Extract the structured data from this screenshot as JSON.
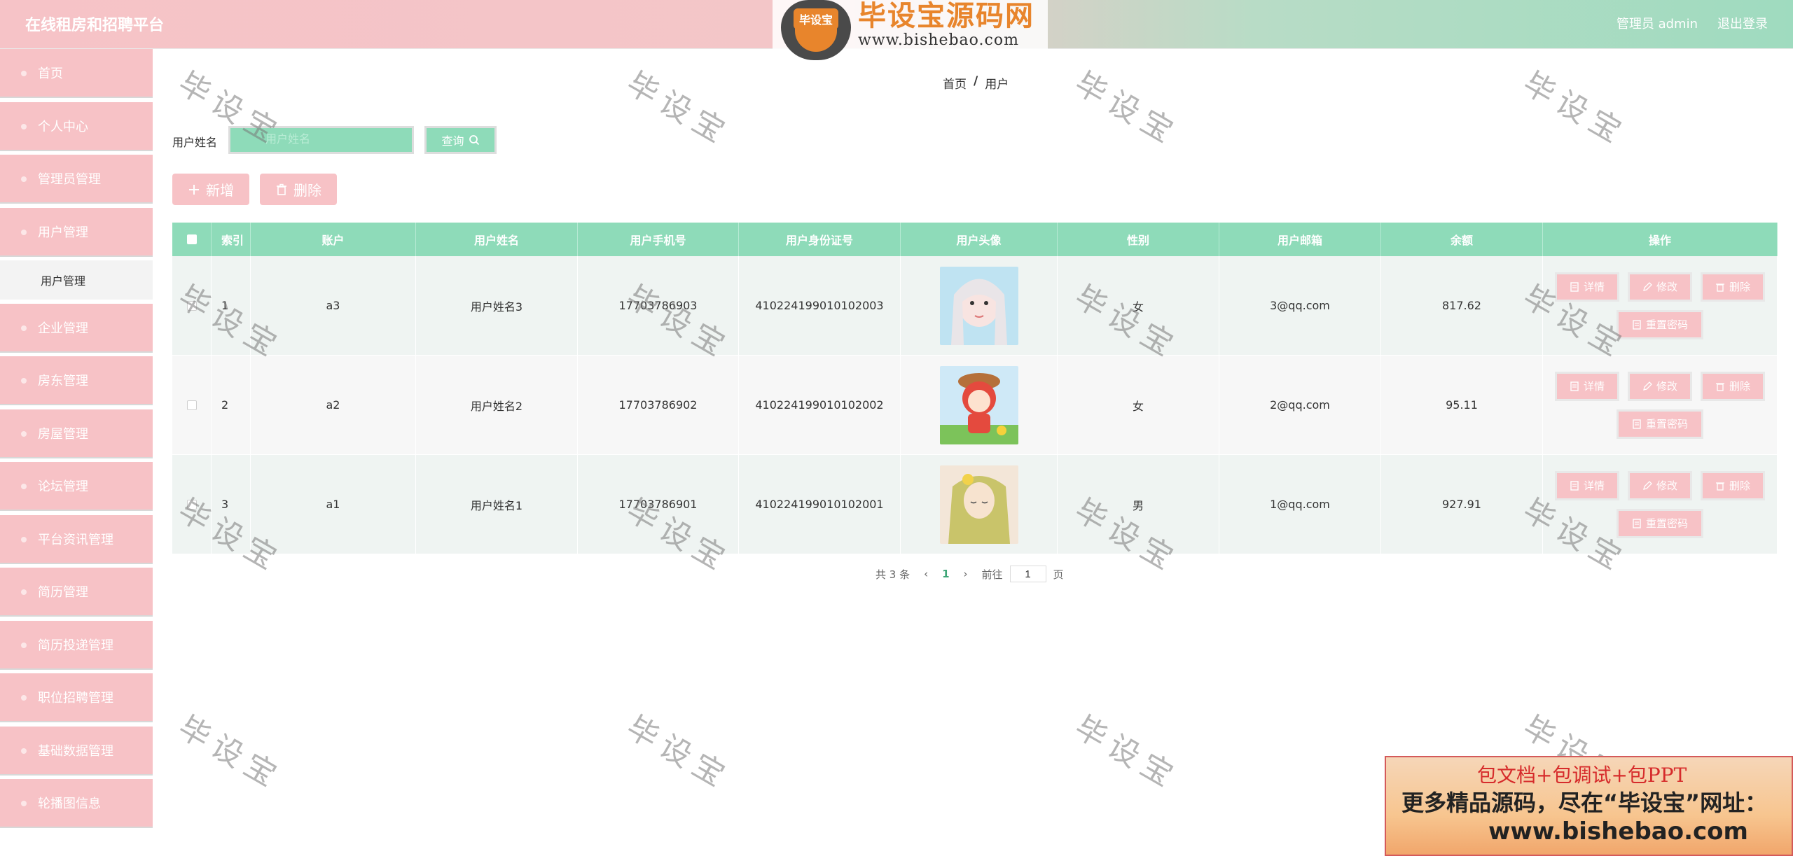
{
  "header": {
    "title": "在线租房和招聘平台",
    "admin_label": "管理员 admin",
    "logout_label": "退出登录"
  },
  "brand": {
    "badge": "毕设宝",
    "name": "毕设宝源码网",
    "url": "www.bishebao.com"
  },
  "sidebar": {
    "items": [
      {
        "label": "首页"
      },
      {
        "label": "个人中心"
      },
      {
        "label": "管理员管理"
      },
      {
        "label": "用户管理"
      },
      {
        "label": "企业管理"
      },
      {
        "label": "房东管理"
      },
      {
        "label": "房屋管理"
      },
      {
        "label": "论坛管理"
      },
      {
        "label": "平台资讯管理"
      },
      {
        "label": "简历管理"
      },
      {
        "label": "简历投递管理"
      },
      {
        "label": "职位招聘管理"
      },
      {
        "label": "基础数据管理"
      },
      {
        "label": "轮播图信息"
      }
    ],
    "submenu": {
      "label": "用户管理"
    }
  },
  "breadcrumb": {
    "home": "首页",
    "sep": "/",
    "current": "用户"
  },
  "search": {
    "label": "用户姓名",
    "placeholder": "用户姓名",
    "button": "查询"
  },
  "actions": {
    "add": "新增",
    "delete": "删除"
  },
  "table": {
    "headers": [
      "索引",
      "账户",
      "用户姓名",
      "用户手机号",
      "用户身份证号",
      "用户头像",
      "性别",
      "用户邮箱",
      "余额",
      "操作"
    ],
    "rows": [
      {
        "index": "1",
        "account": "a3",
        "name": "用户姓名3",
        "phone": "17703786903",
        "id_card": "410224199010102003",
        "sex": "女",
        "email": "3@qq.com",
        "balance": "817.62"
      },
      {
        "index": "2",
        "account": "a2",
        "name": "用户姓名2",
        "phone": "17703786902",
        "id_card": "410224199010102002",
        "sex": "女",
        "email": "2@qq.com",
        "balance": "95.11"
      },
      {
        "index": "3",
        "account": "a1",
        "name": "用户姓名1",
        "phone": "17703786901",
        "id_card": "410224199010102001",
        "sex": "男",
        "email": "1@qq.com",
        "balance": "927.91"
      }
    ],
    "ops": {
      "detail": "详情",
      "edit": "修改",
      "delete": "删除",
      "reset": "重置密码"
    }
  },
  "pager": {
    "total": "共 3 条",
    "prev": "‹",
    "current": "1",
    "next": "›",
    "goto": "前往",
    "page_value": "1",
    "page_unit": "页"
  },
  "watermark": "毕设宝",
  "promo": {
    "line1": "包文档+包调试+包PPT",
    "line2": "更多精品源码，尽在“毕设宝”网址：",
    "line3": "www.bishebao.com"
  },
  "colors": {
    "accent_green": "#8edbb9",
    "accent_pink": "#f7c2c6"
  }
}
